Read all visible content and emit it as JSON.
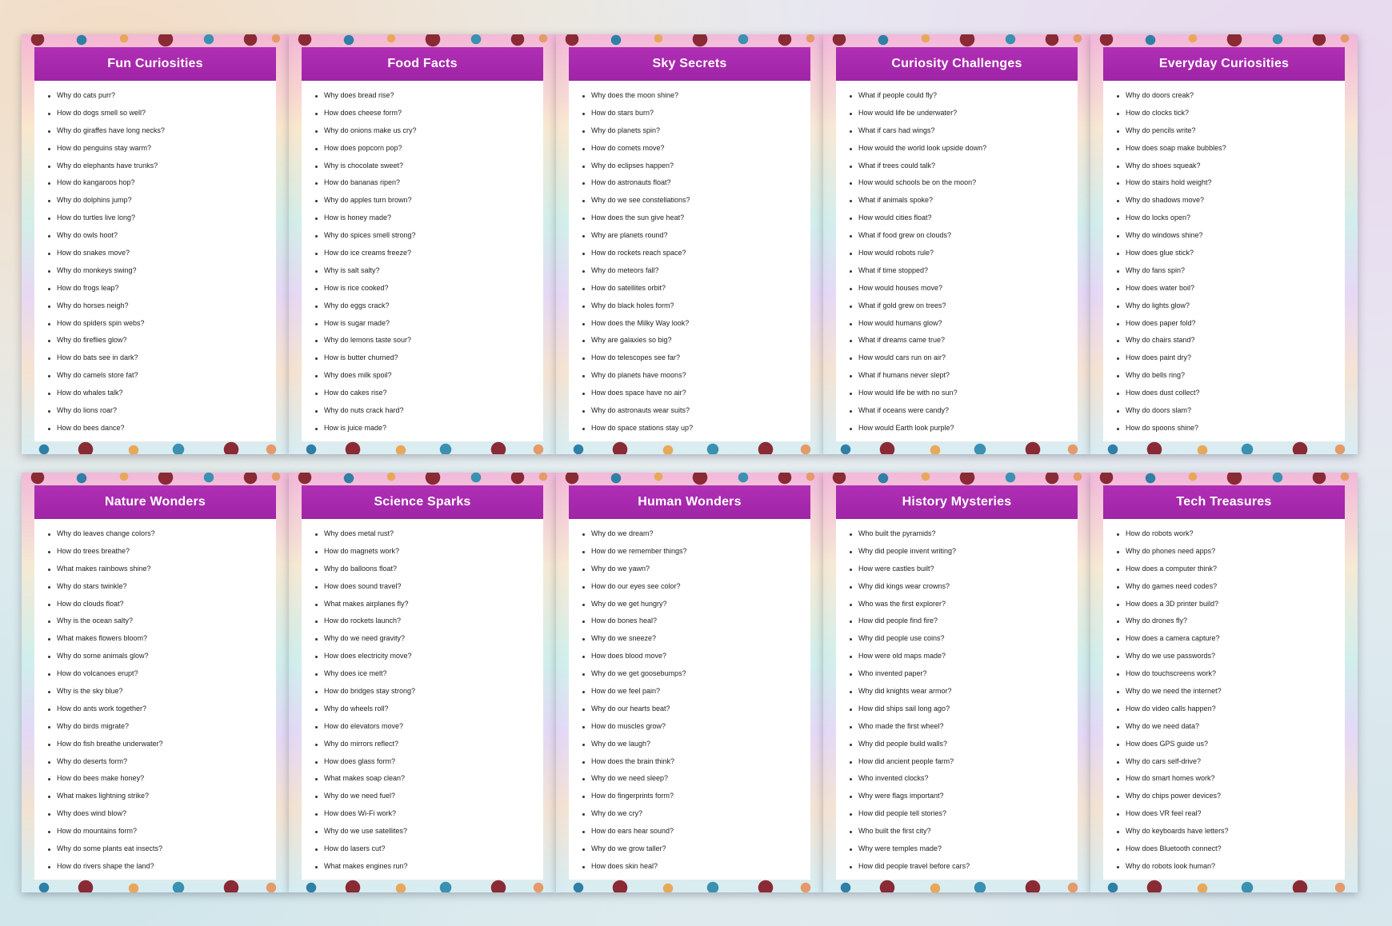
{
  "cards": [
    {
      "title": "Fun Curiosities",
      "questions": [
        "Why do cats purr?",
        "How do dogs smell so well?",
        "Why do giraffes have long necks?",
        "How do penguins stay warm?",
        "Why do elephants have trunks?",
        "How do kangaroos hop?",
        "Why do dolphins jump?",
        "How do turtles live long?",
        "Why do owls hoot?",
        "How do snakes move?",
        "Why do monkeys swing?",
        "How do frogs leap?",
        "Why do horses neigh?",
        "How do spiders spin webs?",
        "Why do fireflies glow?",
        "How do bats see in dark?",
        "Why do camels store fat?",
        "How do whales talk?",
        "Why do lions roar?",
        "How do bees dance?"
      ]
    },
    {
      "title": "Food Facts",
      "questions": [
        "Why does bread rise?",
        "How does cheese form?",
        "Why do onions make us cry?",
        "How does popcorn pop?",
        "Why is chocolate sweet?",
        "How do bananas ripen?",
        "Why do apples turn brown?",
        "How is honey made?",
        "Why do spices smell strong?",
        "How do ice creams freeze?",
        "Why is salt salty?",
        "How is rice cooked?",
        "Why do eggs crack?",
        "How is sugar made?",
        "Why do lemons taste sour?",
        "How is butter churned?",
        "Why does milk spoil?",
        "How do cakes rise?",
        "Why do nuts crack hard?",
        "How is juice made?"
      ]
    },
    {
      "title": "Sky Secrets",
      "questions": [
        "Why does the moon shine?",
        "How do stars burn?",
        "Why do planets spin?",
        "How do comets move?",
        "Why do eclipses happen?",
        "How do astronauts float?",
        "Why do we see constellations?",
        "How does the sun give heat?",
        "Why are planets round?",
        "How do rockets reach space?",
        "Why do meteors fall?",
        "How do satellites orbit?",
        "Why do black holes form?",
        "How does the Milky Way look?",
        "Why are galaxies so big?",
        "How do telescopes see far?",
        "Why do planets have moons?",
        "How does space have no air?",
        "Why do astronauts wear suits?",
        "How do space stations stay up?"
      ]
    },
    {
      "title": "Curiosity Challenges",
      "questions": [
        "What if people could fly?",
        "How would life be underwater?",
        "What if cars had wings?",
        "How would the world look upside down?",
        "What if trees could talk?",
        "How would schools be on the moon?",
        "What if animals spoke?",
        "How would cities float?",
        "What if food grew on clouds?",
        "How would robots rule?",
        "What if time stopped?",
        "How would houses move?",
        "What if gold grew on trees?",
        "How would humans glow?",
        "What if dreams came true?",
        "How would cars run on air?",
        "What if humans never slept?",
        "How would life be with no sun?",
        "What if oceans were candy?",
        "How would Earth look purple?"
      ]
    },
    {
      "title": "Everyday Curiosities",
      "questions": [
        "Why do doors creak?",
        "How do clocks tick?",
        "Why do pencils write?",
        "How does soap make bubbles?",
        "Why do shoes squeak?",
        "How do stairs hold weight?",
        "Why do shadows move?",
        "How do locks open?",
        "Why do windows shine?",
        "How does glue stick?",
        "Why do fans spin?",
        "How does water boil?",
        "Why do lights glow?",
        "How does paper fold?",
        "Why do chairs stand?",
        "How does paint dry?",
        "Why do bells ring?",
        "How does dust collect?",
        "Why do doors slam?",
        "How do spoons shine?"
      ]
    },
    {
      "title": "Nature Wonders",
      "questions": [
        "Why do leaves change colors?",
        "How do trees breathe?",
        "What makes rainbows shine?",
        "Why do stars twinkle?",
        "How do clouds float?",
        "Why is the ocean salty?",
        "What makes flowers bloom?",
        "Why do some animals glow?",
        "How do volcanoes erupt?",
        "Why is the sky blue?",
        "How do ants work together?",
        "Why do birds migrate?",
        "How do fish breathe underwater?",
        "Why do deserts form?",
        "How do bees make honey?",
        "What makes lightning strike?",
        "Why does wind blow?",
        "How do mountains form?",
        "Why do some plants eat insects?",
        "How do rivers shape the land?"
      ]
    },
    {
      "title": "Science Sparks",
      "questions": [
        "Why does metal rust?",
        "How do magnets work?",
        "Why do balloons float?",
        "How does sound travel?",
        "What makes airplanes fly?",
        "How do rockets launch?",
        "Why do we need gravity?",
        "How does electricity move?",
        "Why does ice melt?",
        "How do bridges stay strong?",
        "Why do wheels roll?",
        "How do elevators move?",
        "Why do mirrors reflect?",
        "How does glass form?",
        "What makes soap clean?",
        "Why do we need fuel?",
        "How does Wi-Fi work?",
        "Why do we use satellites?",
        "How do lasers cut?",
        "What makes engines run?"
      ]
    },
    {
      "title": "Human Wonders",
      "questions": [
        "Why do we dream?",
        "How do we remember things?",
        "Why do we yawn?",
        "How do our eyes see color?",
        "Why do we get hungry?",
        "How do bones heal?",
        "Why do we sneeze?",
        "How does blood move?",
        "Why do we get goosebumps?",
        "How do we feel pain?",
        "Why do our hearts beat?",
        "How do muscles grow?",
        "Why do we laugh?",
        "How does the brain think?",
        "Why do we need sleep?",
        "How do fingerprints form?",
        "Why do we cry?",
        "How do ears hear sound?",
        "Why do we grow taller?",
        "How does skin heal?"
      ]
    },
    {
      "title": "History Mysteries",
      "questions": [
        "Who built the pyramids?",
        "Why did people invent writing?",
        "How were castles built?",
        "Why did kings wear crowns?",
        "Who was the first explorer?",
        "How did people find fire?",
        "Why did people use coins?",
        "How were old maps made?",
        "Who invented paper?",
        "Why did knights wear armor?",
        "How did ships sail long ago?",
        "Who made the first wheel?",
        "Why did people build walls?",
        "How did ancient people farm?",
        "Who invented clocks?",
        "Why were flags important?",
        "How did people tell stories?",
        "Who built the first city?",
        "Why were temples made?",
        "How did people travel before cars?"
      ]
    },
    {
      "title": "Tech Treasures",
      "questions": [
        "How do robots work?",
        "Why do phones need apps?",
        "How does a computer think?",
        "Why do games need codes?",
        "How does a 3D printer build?",
        "Why do drones fly?",
        "How does a camera capture?",
        "Why do we use passwords?",
        "How do touchscreens work?",
        "Why do we need the internet?",
        "How do video calls happen?",
        "Why do we need data?",
        "How does GPS guide us?",
        "Why do cars self-drive?",
        "How do smart homes work?",
        "Why do chips power devices?",
        "How does VR feel real?",
        "Why do keyboards have letters?",
        "How does Bluetooth connect?",
        "Why do robots look human?"
      ]
    }
  ]
}
